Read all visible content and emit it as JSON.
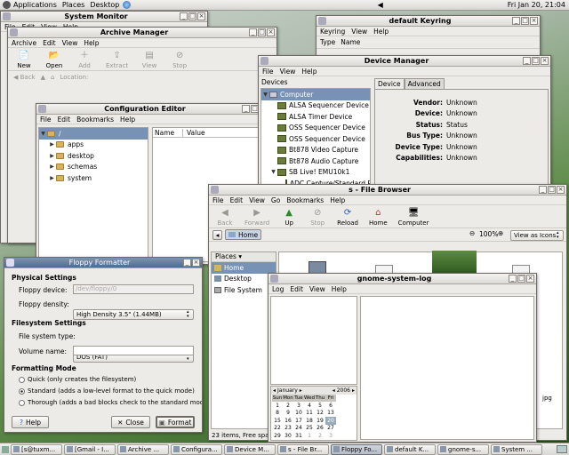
{
  "top_panel": {
    "menus": [
      "Applications",
      "Places",
      "Desktop"
    ],
    "clock": "Fri Jan 20, 21:04"
  },
  "system_monitor": {
    "title": "System Monitor",
    "menu": [
      "File",
      "Edit",
      "View",
      "Help"
    ]
  },
  "archive_manager": {
    "title": "Archive Manager",
    "menu": [
      "Archive",
      "Edit",
      "View",
      "Help"
    ],
    "toolbar": [
      "New",
      "Open",
      "Add",
      "Extract",
      "View",
      "Stop"
    ],
    "nav": {
      "back": "Back",
      "location": "Location:"
    }
  },
  "config_editor": {
    "title": "Configuration Editor",
    "menu": [
      "File",
      "Edit",
      "Bookmarks",
      "Help"
    ],
    "root": "/",
    "tree": [
      "apps",
      "desktop",
      "schemas",
      "system"
    ],
    "columns": [
      "Name",
      "Value"
    ]
  },
  "keyring": {
    "title": "default Keyring",
    "menu": [
      "Keyring",
      "View",
      "Help"
    ],
    "columns": [
      "Type",
      "Name"
    ]
  },
  "device_manager": {
    "title": "Device Manager",
    "menu": [
      "File",
      "View",
      "Help"
    ],
    "devices_label": "Devices",
    "root": "Computer",
    "devices": [
      "ALSA Sequencer Device",
      "ALSA Timer Device",
      "OSS Sequencer Device",
      "OSS Sequencer Device",
      "Bt878 Video Capture",
      "Bt878 Audio Capture",
      "SB Live! EMU10k1",
      "ADC Capture/Standard P"
    ],
    "tabs": [
      "Device",
      "Advanced"
    ],
    "props": [
      {
        "k": "Vendor:",
        "v": "Unknown"
      },
      {
        "k": "Device:",
        "v": "Unknown"
      },
      {
        "k": "Status:",
        "v": "Status"
      },
      {
        "k": "Bus Type:",
        "v": "Unknown"
      },
      {
        "k": "Device Type:",
        "v": "Unknown"
      },
      {
        "k": "Capabilities:",
        "v": "Unknown"
      }
    ]
  },
  "file_browser": {
    "title": "s - File Browser",
    "menu": [
      "File",
      "Edit",
      "View",
      "Go",
      "Bookmarks",
      "Help"
    ],
    "toolbar": [
      "Back",
      "Forward",
      "Up",
      "Stop",
      "Reload",
      "Home",
      "Computer"
    ],
    "location": "Home",
    "zoom": "100%",
    "view_mode": "View as Icons",
    "places_label": "Places",
    "places": [
      "Home",
      "Desktop",
      "File System"
    ],
    "status": "23 items, Free spac",
    "partial_label": "jpg"
  },
  "syslog": {
    "title": "gnome-system-log",
    "menu": [
      "Log",
      "Edit",
      "View",
      "Help"
    ],
    "month": "January",
    "year": "2006",
    "weekdays": [
      "Sun",
      "Mon",
      "Tue",
      "Wed",
      "Thu",
      "Fri"
    ],
    "weeks": [
      [
        "1",
        "2",
        "3",
        "4",
        "5",
        "6"
      ],
      [
        "8",
        "9",
        "10",
        "11",
        "12",
        "13"
      ],
      [
        "15",
        "16",
        "17",
        "18",
        "19",
        "20"
      ],
      [
        "22",
        "23",
        "24",
        "25",
        "26",
        "27"
      ],
      [
        "29",
        "30",
        "31",
        "1",
        "2",
        "3"
      ]
    ]
  },
  "floppy": {
    "title": "Floppy Formatter",
    "physical_heading": "Physical Settings",
    "device_label": "Floppy device:",
    "device_value": "/dev/floppy/0",
    "density_label": "Floppy density:",
    "density_value": "High Density 3.5\" (1.44MB)",
    "fs_heading": "Filesystem Settings",
    "fs_label": "File system type:",
    "fs_value": "DOS (FAT)",
    "volume_label": "Volume name:",
    "volume_value": "",
    "mode_heading": "Formatting Mode",
    "modes": [
      "Quick (only creates the filesystem)",
      "Standard (adds a low-level format to the quick mode)",
      "Thorough (adds a bad blocks check to the standard mode)"
    ],
    "help": "Help",
    "close": "Close",
    "format": "Format"
  },
  "taskbar": [
    "[s@tuxm...",
    "[Gmail - I...",
    "Archive ...",
    "Configura...",
    "Device M...",
    "s - File Br...",
    "Floppy Fo...",
    "default K...",
    "gnome-s...",
    "System ..."
  ]
}
